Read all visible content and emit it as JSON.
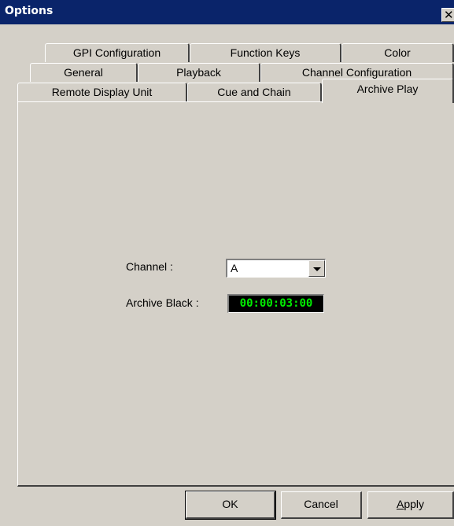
{
  "window": {
    "title": "Options",
    "close_glyph": "✕"
  },
  "tabs": {
    "row1": [
      "GPI Configuration",
      "Function Keys",
      "Color"
    ],
    "row2": [
      "General",
      "Playback",
      "Channel Configuration"
    ],
    "row3": [
      "Remote Display Unit",
      "Cue and Chain",
      "Archive Play"
    ],
    "active": "Archive Play"
  },
  "archive_play": {
    "channel_label": "Channel :",
    "channel_value": "A",
    "archive_black_label": "Archive Black :",
    "archive_black_value": "00:00:03:00"
  },
  "buttons": {
    "ok": "OK",
    "cancel": "Cancel",
    "apply_first": "A",
    "apply_rest": "pply"
  },
  "colors": {
    "titlebar": "#0a246a",
    "face": "#d4d0c8",
    "timecode_bg": "#000000",
    "timecode_fg": "#00ee00"
  }
}
